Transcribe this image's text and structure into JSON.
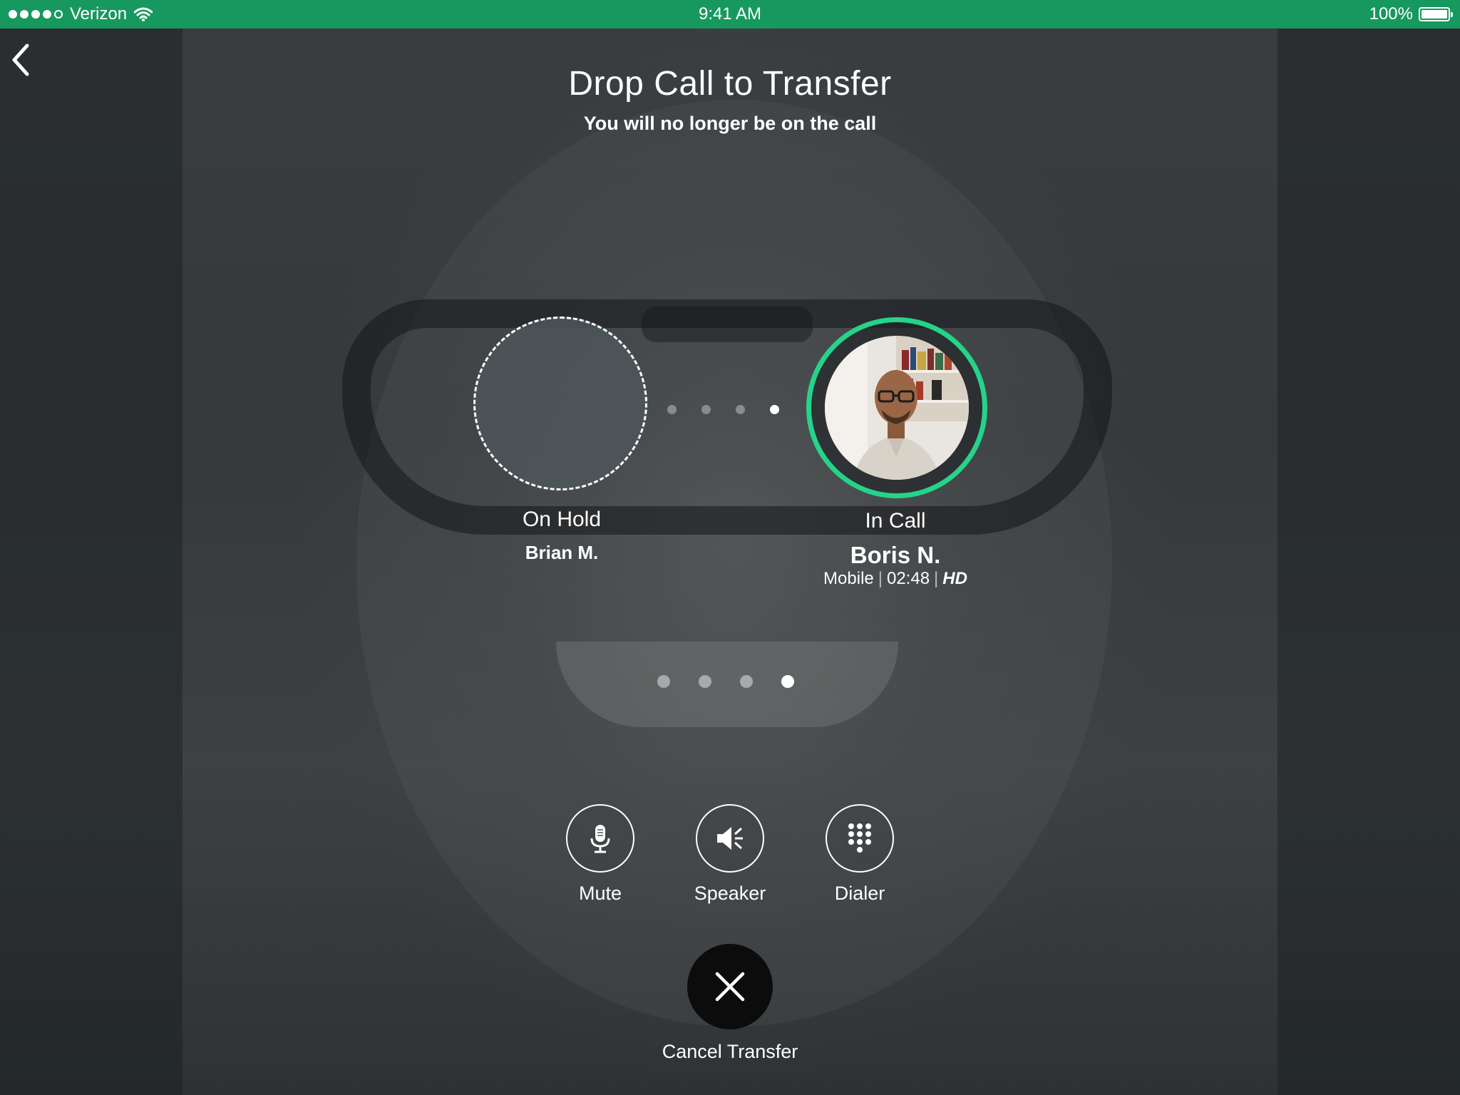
{
  "status_bar": {
    "carrier": "Verizon",
    "time": "9:41 AM",
    "battery": "100%"
  },
  "header": {
    "title": "Drop Call to Transfer",
    "subtitle": "You will no longer be on the call"
  },
  "on_hold": {
    "label": "On Hold",
    "name": "Brian M."
  },
  "in_call": {
    "label": "In Call",
    "name": "Boris N.",
    "phone_type": "Mobile",
    "duration": "02:48",
    "quality": "HD"
  },
  "pager": {
    "count": 4,
    "active_index": 3
  },
  "controls": {
    "mute": {
      "label": "Mute",
      "icon": "microphone-icon"
    },
    "speaker": {
      "label": "Speaker",
      "icon": "speaker-icon"
    },
    "dialer": {
      "label": "Dialer",
      "icon": "keypad-icon"
    }
  },
  "cancel": {
    "label": "Cancel Transfer",
    "icon": "close-icon"
  },
  "colors": {
    "status_bar": "#17985f",
    "in_call_ring": "#25d38a",
    "cancel_button": "#0c0c0c"
  }
}
